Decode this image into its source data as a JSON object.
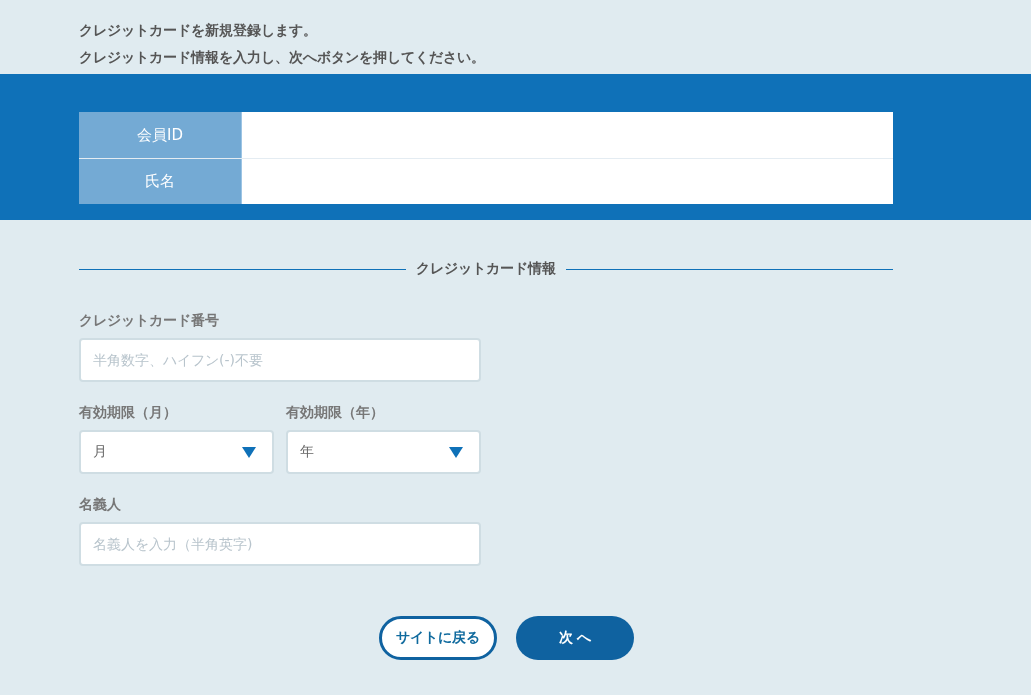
{
  "intro": [
    "クレジットカードを新規登録します。",
    "クレジットカード情報を入力し、次へボタンを押してください。"
  ],
  "member_table": [
    {
      "label": "会員ID"
    },
    {
      "label": "氏名"
    }
  ],
  "section_title": "クレジットカード情報",
  "card_number": {
    "label": "クレジットカード番号",
    "placeholder": "半角数字、ハイフン(-)不要"
  },
  "expiry": [
    {
      "label": "有効期限（月）",
      "value": "月"
    },
    {
      "label": "有効期限（年）",
      "value": "年"
    }
  ],
  "holder": {
    "label": "名義人",
    "placeholder": "名義人を入力（半角英字)"
  },
  "buttons": [
    {
      "kind": "secondary",
      "label": "サイトに戻る"
    },
    {
      "kind": "primary",
      "label": "次 へ"
    }
  ]
}
